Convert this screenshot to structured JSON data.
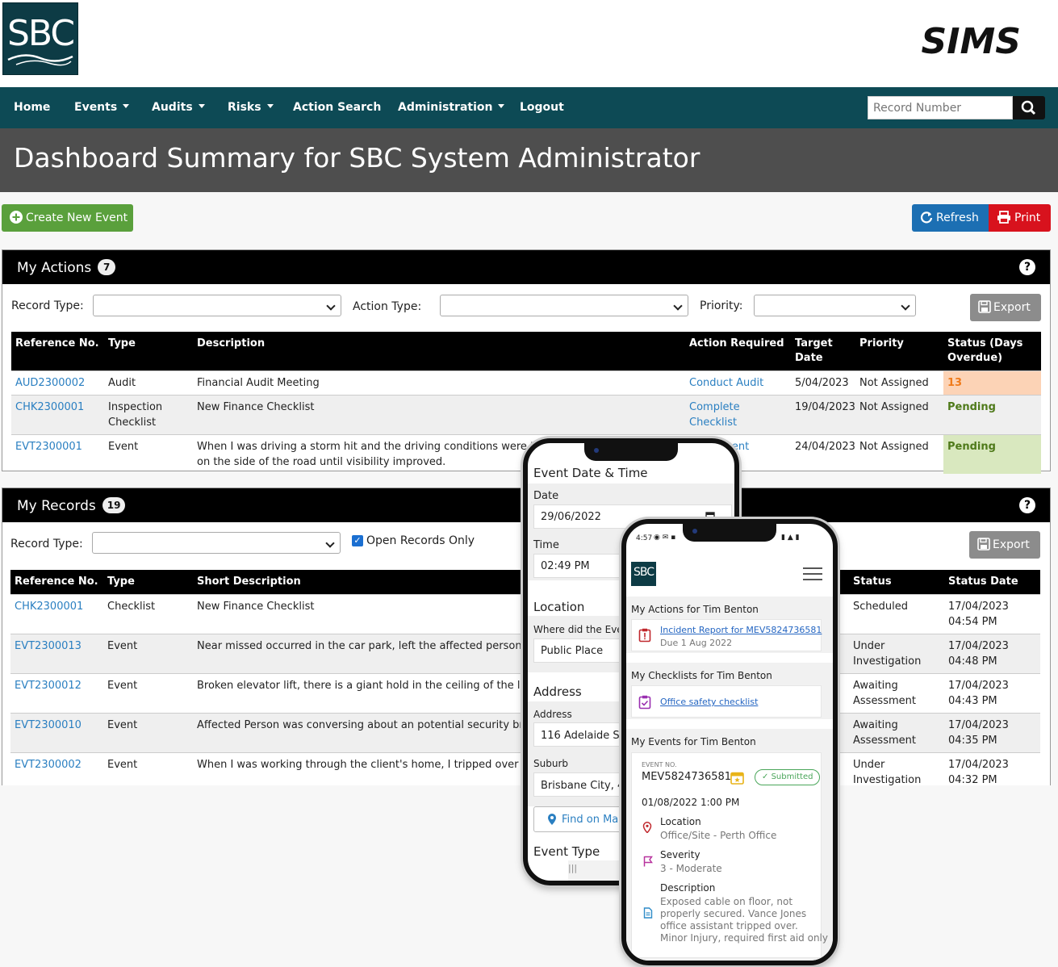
{
  "brand": {
    "logo_text": "SBC",
    "app_name": "SIMS"
  },
  "nav": {
    "home": "Home",
    "events": "Events",
    "audits": "Audits",
    "risks": "Risks",
    "action_search": "Action Search",
    "administration": "Administration",
    "logout": "Logout",
    "search_placeholder": "Record Number"
  },
  "page_title": "Dashboard Summary for SBC System Administrator",
  "buttons": {
    "create": "Create New Event",
    "refresh": "Refresh",
    "print": "Print",
    "export": "Export"
  },
  "colors": {
    "nav": "#0d4a55",
    "title_bar": "#4e4e4e",
    "green": "#5aa03c",
    "blue": "#1c6fb3",
    "red": "#d8121d",
    "link": "#2a7fc1"
  },
  "my_actions": {
    "title": "My Actions",
    "count": "7",
    "filters": {
      "record_type": "Record Type:",
      "action_type": "Action Type:",
      "priority": "Priority:"
    },
    "columns": [
      "Reference No.",
      "Type",
      "Description",
      "Action Required",
      "Target Date",
      "Priority",
      "Status (Days Overdue)"
    ],
    "rows": [
      {
        "ref": "AUD2300002",
        "type": "Audit",
        "desc": "Financial Audit Meeting",
        "action": "Conduct Audit",
        "date": "5/04/2023",
        "priority": "Not Assigned",
        "status": "13"
      },
      {
        "ref": "CHK2300001",
        "type": "Inspection Checklist",
        "desc": "New Finance Checklist",
        "action": "Complete Checklist",
        "date": "19/04/2023",
        "priority": "Not Assigned",
        "status": "Pending"
      },
      {
        "ref": "EVT2300001",
        "type": "Event",
        "desc": "When I was driving a storm hit and the driving conditions were too dange",
        "desc2": "on the side of the road until visibility improved.",
        "action": "Event",
        "date": "24/04/2023",
        "priority": "Not Assigned",
        "status": "Pending"
      }
    ]
  },
  "my_records": {
    "title": "My Records",
    "count": "19",
    "filters": {
      "record_type": "Record Type:",
      "open_only": "Open Records Only"
    },
    "columns": [
      "Reference No.",
      "Type",
      "Short Description",
      "Status",
      "Status Date"
    ],
    "rows": [
      {
        "ref": "CHK2300001",
        "type": "Checklist",
        "desc": "New Finance Checklist",
        "status": "Scheduled",
        "date": "17/04/2023 04:54 PM"
      },
      {
        "ref": "EVT2300013",
        "type": "Event",
        "desc": "Near missed occurred in the car park, left the affected person menta",
        "status": "Under Investigation",
        "date": "17/04/2023 04:48 PM"
      },
      {
        "ref": "EVT2300012",
        "type": "Event",
        "desc": "Broken elevator lift, there is a giant hold in the ceiling of the lift",
        "status": "Awaiting Assessment",
        "date": "17/04/2023 04:43 PM"
      },
      {
        "ref": "EVT2300010",
        "type": "Event",
        "desc": "Affected Person was conversing about an potential security breach",
        "status": "Awaiting Assessment",
        "date": "17/04/2023 04:35 PM"
      },
      {
        "ref": "EVT2300002",
        "type": "Event",
        "desc": "When I was working through the client's home, I tripped over an exte",
        "status": "Under Investigation",
        "date": "17/04/2023 04:32 PM"
      }
    ]
  },
  "phone1": {
    "heading": "Event Date & Time",
    "date_label": "Date",
    "date_value": "29/06/2022",
    "time_label": "Time",
    "time_value": "02:49 PM",
    "location_heading": "Location",
    "where_label": "Where did the Even",
    "where_value": "Public Place",
    "address_heading": "Address",
    "address_label": "Address",
    "address_value": "116 Adelaide Stre",
    "suburb_label": "Suburb",
    "suburb_value": "Brisbane City, 400",
    "map_button": "Find on Map",
    "event_type_heading": "Event Type"
  },
  "phone2": {
    "status_time": "4:57",
    "my_actions": "My Actions for Tim Benton",
    "action_link": "Incident Report for MEV5824736581",
    "action_due": "Due 1 Aug 2022",
    "my_checklists": "My Checklists for Tim Benton",
    "checklist_link": "Office safety checklist",
    "my_events": "My Events for Tim Benton",
    "event_no_label": "EVENT NO.",
    "event_no": "MEV5824736581",
    "submitted": "Submitted",
    "event_date": "01/08/2022 1:00 PM",
    "location_label": "Location",
    "location_value": "Office/Site - Perth Office",
    "severity_label": "Severity",
    "severity_value": "3 - Moderate",
    "description_label": "Description",
    "description_lines": [
      "Exposed cable on floor, not",
      "properly secured. Vance Jones",
      "office assistant tripped over.",
      "Minor Injury, required first aid only"
    ]
  }
}
